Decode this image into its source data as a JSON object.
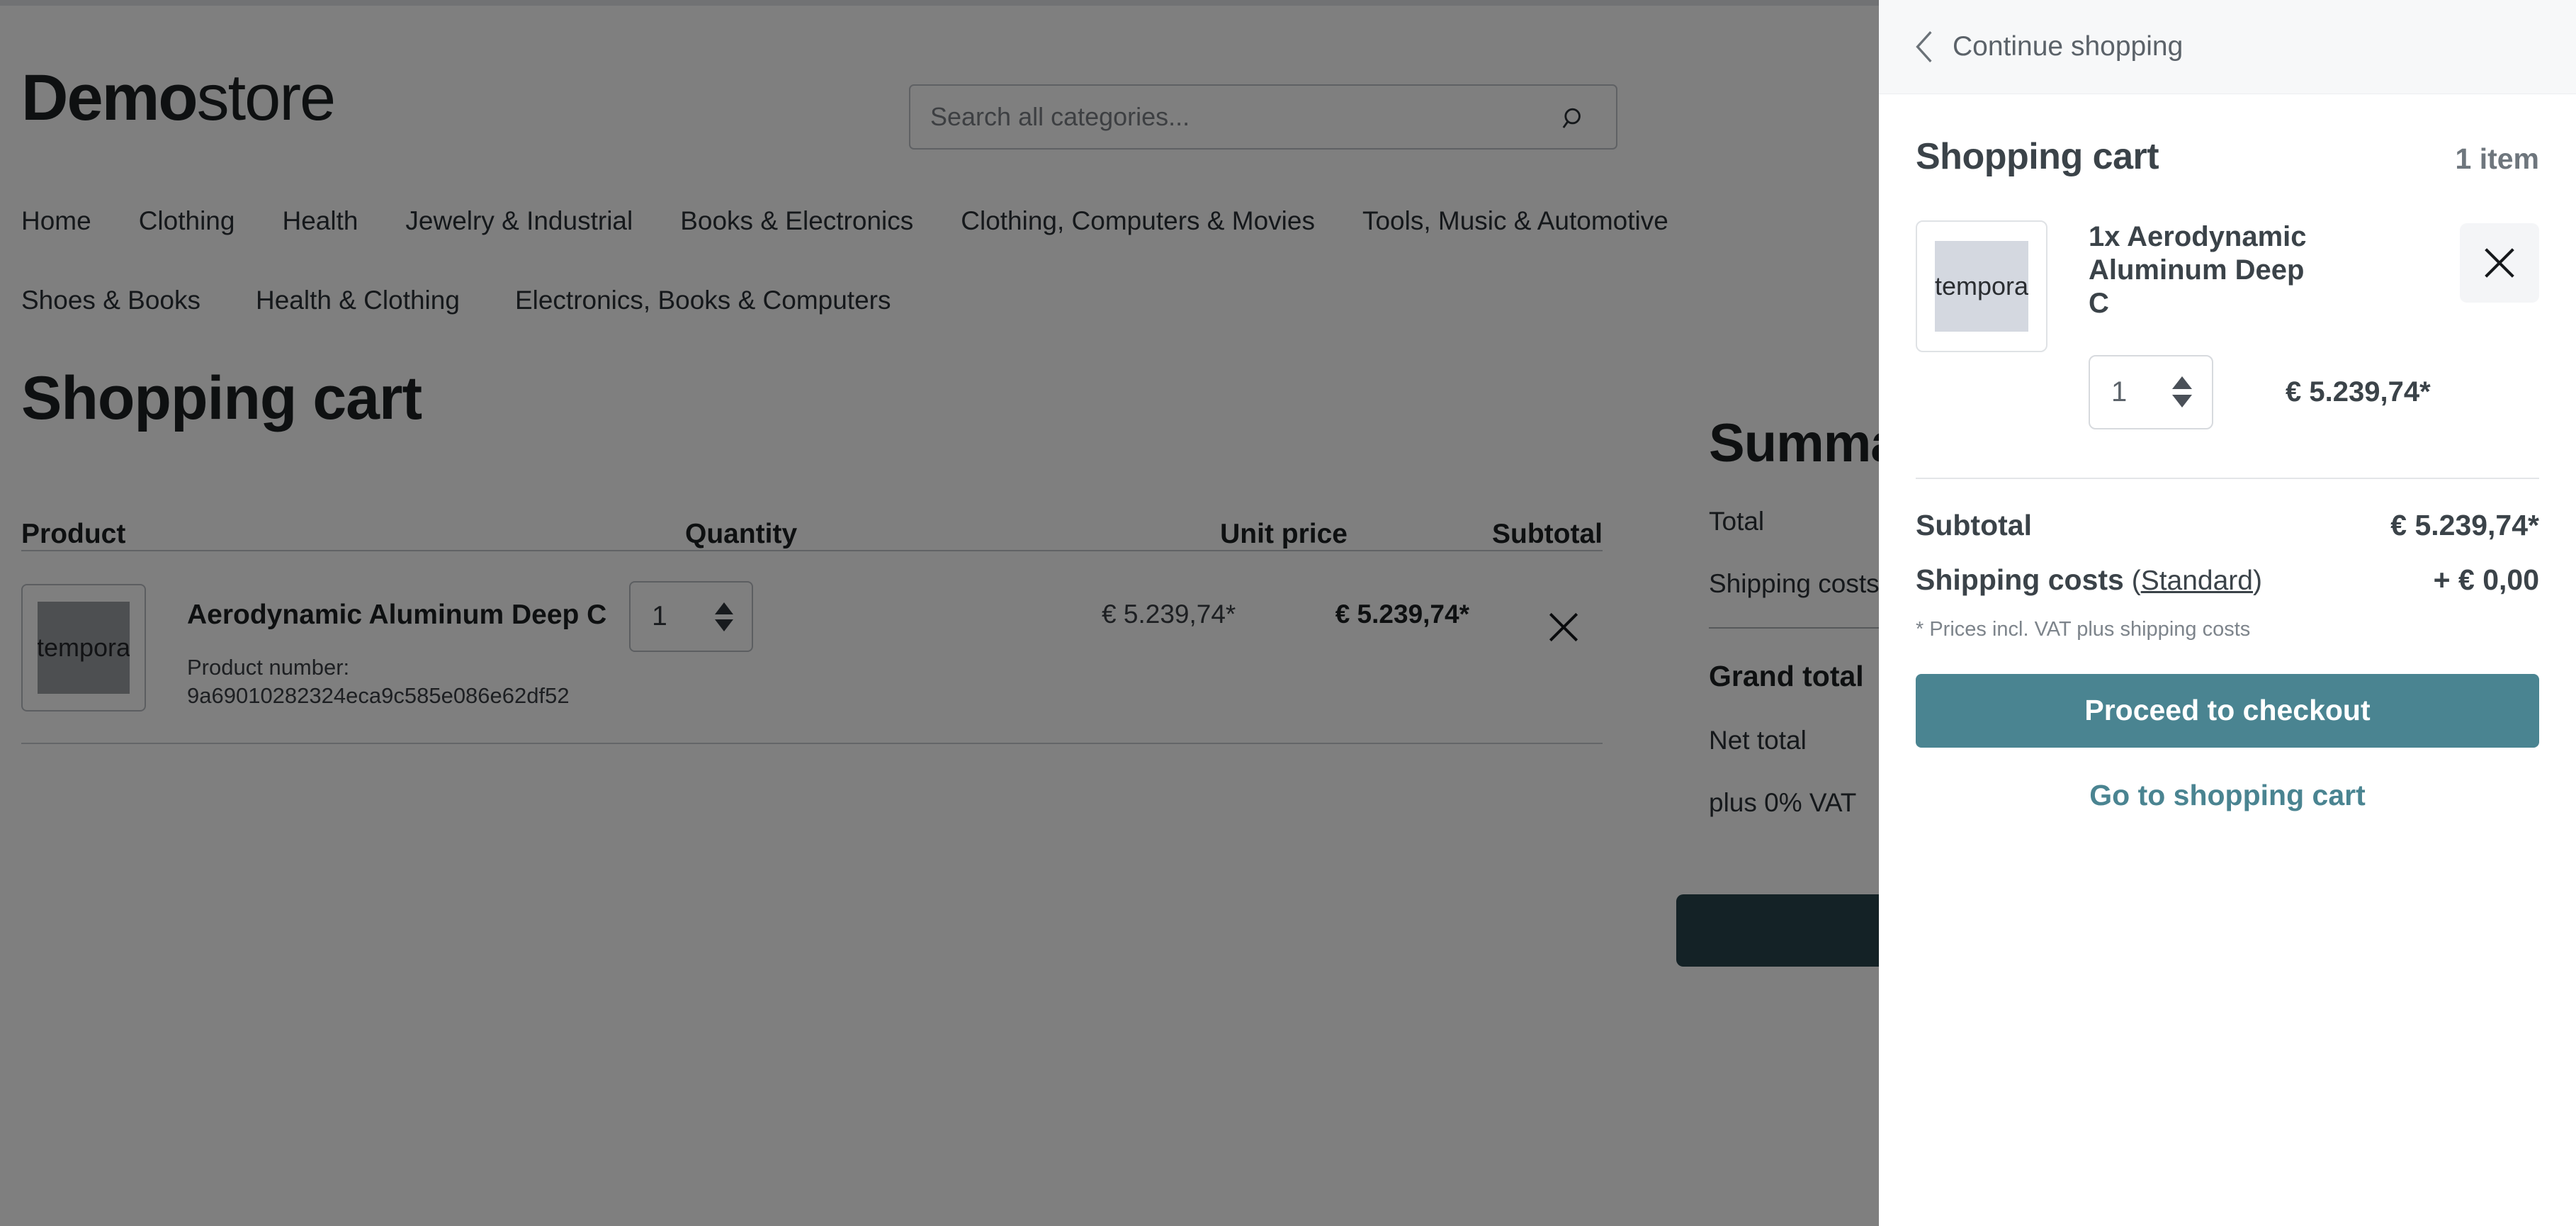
{
  "site": {
    "brand_bold": "Demo",
    "brand_light": "store"
  },
  "search": {
    "placeholder": "Search all categories...",
    "icon": "search-icon"
  },
  "nav": {
    "row1": [
      "Home",
      "Clothing",
      "Health",
      "Jewelry & Industrial",
      "Books & Electronics",
      "Clothing, Computers & Movies",
      "Tools, Music & Automotive"
    ],
    "row2": [
      "Shoes & Books",
      "Health & Clothing",
      "Electronics, Books & Computers"
    ]
  },
  "main": {
    "page_title": "Shopping cart",
    "table": {
      "headers": [
        "Product",
        "Quantity",
        "Unit price",
        "Subtotal"
      ],
      "rows": [
        {
          "thumb_text": "tempora",
          "name": "Aerodynamic Aluminum Deep C",
          "product_number_label": "Product number:",
          "product_number": "9a69010282324eca9c585e086e62df52",
          "quantity": "1",
          "unit_price": "€ 5.239,74*",
          "subtotal": "€ 5.239,74*",
          "remove_icon": "close-icon"
        }
      ]
    },
    "summary": {
      "title": "Summary",
      "rows": [
        {
          "label": "Total",
          "value": ""
        },
        {
          "label": "Shipping costs",
          "value": ""
        }
      ],
      "grand_total_label": "Grand total",
      "grand_total_value": "",
      "net_total_label": "Net total",
      "net_total_value": "",
      "vat_label": "plus 0% VAT",
      "vat_value": ""
    }
  },
  "offcanvas": {
    "back_label": "Continue shopping",
    "back_icon": "chevron-left-icon",
    "title": "Shopping cart",
    "item_count": "1 item",
    "item": {
      "thumb_text": "tempora",
      "name": "1x Aerodynamic Aluminum Deep C",
      "quantity": "1",
      "price": "€ 5.239,74*",
      "close_icon": "close-icon"
    },
    "subtotal_label": "Subtotal",
    "subtotal_value": "€ 5.239,74*",
    "shipping_label": "Shipping costs",
    "shipping_option_open": " (",
    "shipping_option": "Standard",
    "shipping_option_close": ")",
    "shipping_value": "+ € 0,00",
    "vat_note": "* Prices incl. VAT plus shipping costs",
    "checkout_label": "Proceed to checkout",
    "goto_cart_label": "Go to shopping cart"
  },
  "colors": {
    "accent": "#4a8491",
    "accent_dark": "#29444c",
    "text": "#3b4349",
    "overlay": "rgba(0,0,0,0.50)"
  }
}
